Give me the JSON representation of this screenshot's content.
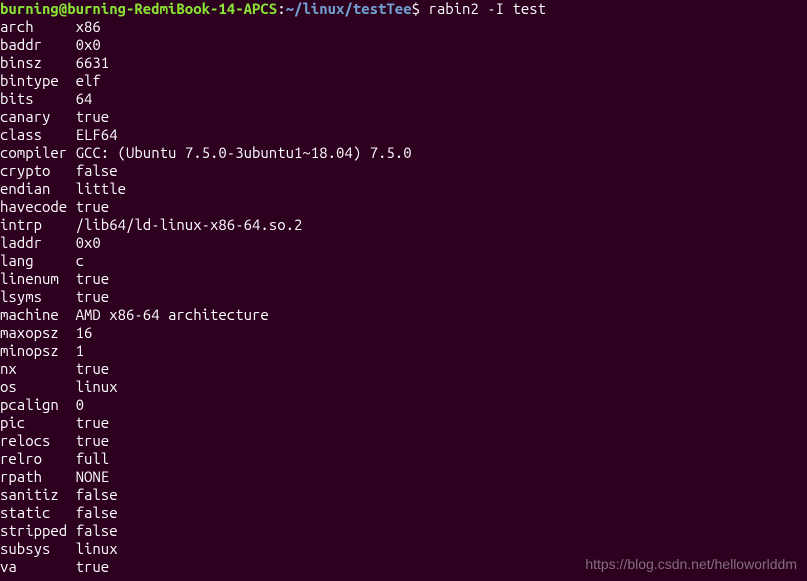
{
  "prompt": {
    "user_host": "burning@burning-RedmiBook-14-APCS",
    "colon": ":",
    "path": "~/linux/testTee",
    "dollar": "$ ",
    "command": "rabin2 -I test"
  },
  "output": [
    {
      "key": "arch",
      "value": "x86"
    },
    {
      "key": "baddr",
      "value": "0x0"
    },
    {
      "key": "binsz",
      "value": "6631"
    },
    {
      "key": "bintype",
      "value": "elf"
    },
    {
      "key": "bits",
      "value": "64"
    },
    {
      "key": "canary",
      "value": "true"
    },
    {
      "key": "class",
      "value": "ELF64"
    },
    {
      "key": "compiler",
      "value": "GCC: (Ubuntu 7.5.0-3ubuntu1~18.04) 7.5.0"
    },
    {
      "key": "crypto",
      "value": "false"
    },
    {
      "key": "endian",
      "value": "little"
    },
    {
      "key": "havecode",
      "value": "true"
    },
    {
      "key": "intrp",
      "value": "/lib64/ld-linux-x86-64.so.2"
    },
    {
      "key": "laddr",
      "value": "0x0"
    },
    {
      "key": "lang",
      "value": "c"
    },
    {
      "key": "linenum",
      "value": "true"
    },
    {
      "key": "lsyms",
      "value": "true"
    },
    {
      "key": "machine",
      "value": "AMD x86-64 architecture"
    },
    {
      "key": "maxopsz",
      "value": "16"
    },
    {
      "key": "minopsz",
      "value": "1"
    },
    {
      "key": "nx",
      "value": "true"
    },
    {
      "key": "os",
      "value": "linux"
    },
    {
      "key": "pcalign",
      "value": "0"
    },
    {
      "key": "pic",
      "value": "true"
    },
    {
      "key": "relocs",
      "value": "true"
    },
    {
      "key": "relro",
      "value": "full"
    },
    {
      "key": "rpath",
      "value": "NONE"
    },
    {
      "key": "sanitiz",
      "value": "false"
    },
    {
      "key": "static",
      "value": "false"
    },
    {
      "key": "stripped",
      "value": "false"
    },
    {
      "key": "subsys",
      "value": "linux"
    },
    {
      "key": "va",
      "value": "true"
    }
  ],
  "watermark": "https://blog.csdn.net/helloworlddm"
}
